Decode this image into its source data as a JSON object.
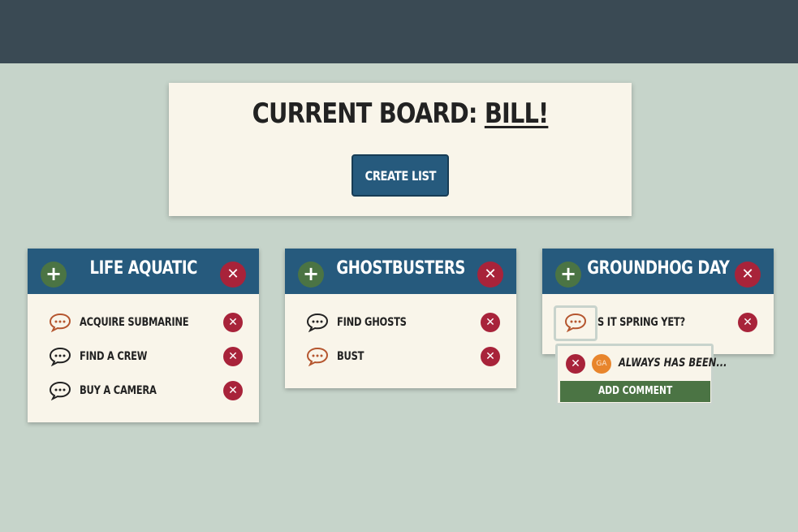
{
  "board": {
    "title_prefix": "CURRENT BOARD: ",
    "name": "BILL!",
    "create_list_label": "CREATE LIST"
  },
  "colors": {
    "header": "#3a4a54",
    "background": "#c6d4ca",
    "list_header": "#265a7d",
    "add_green": "#4b7444",
    "delete_red": "#a8233a",
    "comment_active": "#b5562f"
  },
  "lists": [
    {
      "title": "LIFE AQUATIC",
      "cards": [
        {
          "label": "ACQUIRE SUBMARINE",
          "has_comments": true
        },
        {
          "label": "FIND A CREW",
          "has_comments": false
        },
        {
          "label": "BUY A CAMERA",
          "has_comments": false
        }
      ]
    },
    {
      "title": "GHOSTBUSTERS",
      "cards": [
        {
          "label": "FIND GHOSTS",
          "has_comments": false
        },
        {
          "label": "BUST",
          "has_comments": true
        }
      ]
    },
    {
      "title": "GROUNDHOG DAY",
      "cards": [
        {
          "label": "IS IT SPRING YET?",
          "has_comments": true
        }
      ]
    }
  ],
  "comment_popover": {
    "avatar_initials": "GA",
    "comment_text": "ALWAYS HAS BEEN...",
    "add_comment_label": "ADD COMMENT"
  },
  "icons": {
    "add": "+",
    "delete": "✕"
  }
}
